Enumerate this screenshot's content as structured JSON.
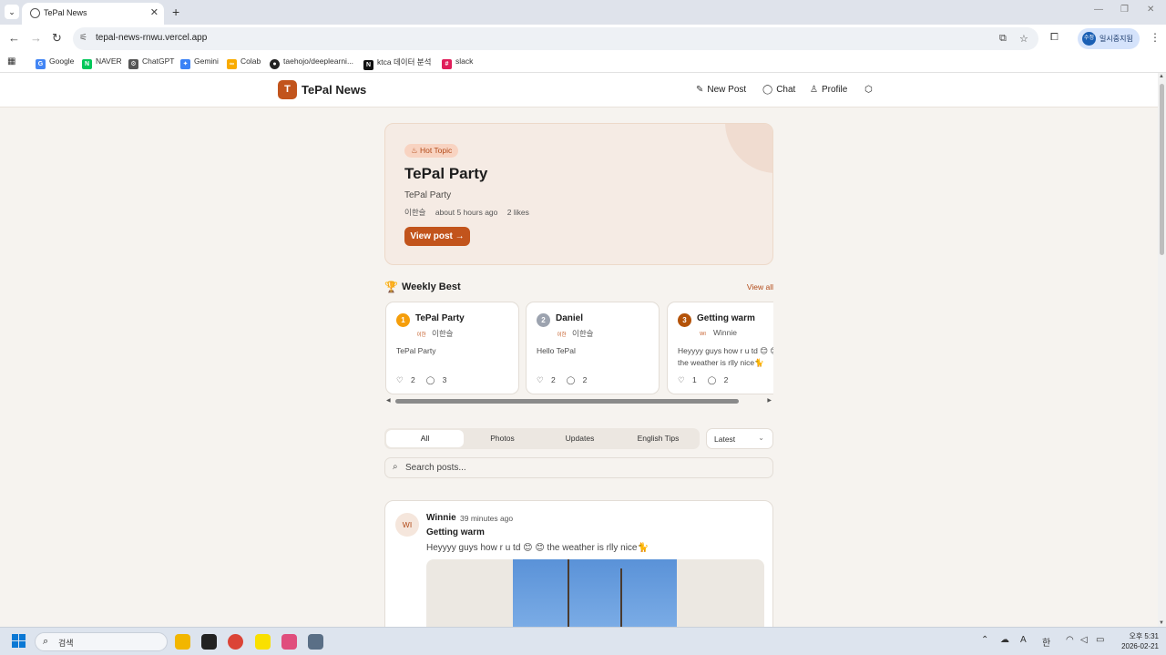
{
  "browser": {
    "tab_title": "TePal News",
    "url": "tepal-news-rnwu.vercel.app",
    "profile_label": "일시중지됨",
    "profile_badge": "수정",
    "bookmarks": [
      {
        "label": "Google",
        "color": "#4285f4",
        "glyph": "G"
      },
      {
        "label": "NAVER",
        "color": "#03c75a",
        "glyph": "N"
      },
      {
        "label": "ChatGPT",
        "color": "#555555",
        "glyph": "⚙"
      },
      {
        "label": "Gemini",
        "color": "#3b82f6",
        "glyph": "✦"
      },
      {
        "label": "Colab",
        "color": "#f9ab00",
        "glyph": "∞"
      },
      {
        "label": "taehojo/deeplearni...",
        "color": "#222222",
        "glyph": "●"
      },
      {
        "label": "ktca 데이터 분석",
        "color": "#111111",
        "glyph": "N"
      },
      {
        "label": "slack",
        "color": "#e01e5a",
        "glyph": "#"
      }
    ]
  },
  "app": {
    "logo_letter": "T",
    "name": "TePal News",
    "nav": {
      "new_post": "New Post",
      "chat": "Chat",
      "profile": "Profile"
    }
  },
  "hot_topic": {
    "badge": "Hot Topic",
    "title": "TePal Party",
    "subtitle": "TePal Party",
    "author": "이한슬",
    "time": "about 5 hours ago",
    "likes": "2 likes",
    "button": "View post"
  },
  "weekly_best": {
    "heading": "Weekly Best",
    "view_all": "View all",
    "items": [
      {
        "rank": "1",
        "rank_color": "#f59e0b",
        "title": "TePal Party",
        "avatar": "이한",
        "author": "이한슬",
        "body": [
          "TePal Party"
        ],
        "likes": "2",
        "comments": "3"
      },
      {
        "rank": "2",
        "rank_color": "#9ca3af",
        "title": "Daniel",
        "avatar": "이한",
        "author": "이한슬",
        "body": [
          "Hello TePal"
        ],
        "likes": "2",
        "comments": "2"
      },
      {
        "rank": "3",
        "rank_color": "#b45309",
        "title": "Getting warm",
        "avatar": "WI",
        "author": "Winnie",
        "body": [
          "Heyyyy guys how r u td 😊 😊",
          "the weather is rlly nice🐈"
        ],
        "likes": "1",
        "comments": "2"
      }
    ]
  },
  "filters": {
    "tabs": [
      "All",
      "Photos",
      "Updates",
      "English Tips"
    ],
    "active": "All",
    "sort": "Latest"
  },
  "search": {
    "placeholder": "Search posts..."
  },
  "posts": [
    {
      "avatar": "WI",
      "author": "Winnie",
      "time": "39 minutes ago",
      "title": "Getting warm",
      "body": "Heyyyy guys how r u td 😊 😊  the weather is rlly nice🐈"
    }
  ],
  "taskbar": {
    "search_label": "검색",
    "clock_time": "오후 5:31",
    "clock_date": "2026-02-21",
    "ime": "한"
  }
}
